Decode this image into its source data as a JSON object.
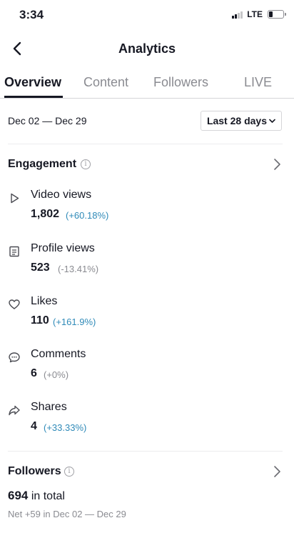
{
  "status_bar": {
    "time": "3:34",
    "network": "LTE"
  },
  "nav": {
    "title": "Analytics"
  },
  "tabs": [
    {
      "label": "Overview",
      "active": true
    },
    {
      "label": "Content",
      "active": false
    },
    {
      "label": "Followers",
      "active": false
    },
    {
      "label": "LIVE",
      "active": false
    }
  ],
  "date_range": "Dec 02 — Dec 29",
  "period_select": {
    "label": "Last 28 days"
  },
  "engagement": {
    "title": "Engagement",
    "info_icon": "i",
    "metrics": [
      {
        "icon": "play-icon",
        "label": "Video views",
        "value": "1,802",
        "change": "(+60.18%)",
        "trend": "positive"
      },
      {
        "icon": "profile-icon",
        "label": "Profile views",
        "value": "523",
        "change": "(-13.41%)",
        "trend": "neutral"
      },
      {
        "icon": "heart-icon",
        "label": "Likes",
        "value": "110",
        "change": "(+161.9%)",
        "trend": "positive"
      },
      {
        "icon": "comment-icon",
        "label": "Comments",
        "value": "6",
        "change": "(+0%)",
        "trend": "neutral"
      },
      {
        "icon": "share-icon",
        "label": "Shares",
        "value": "4",
        "change": "(+33.33%)",
        "trend": "positive"
      }
    ]
  },
  "followers": {
    "title": "Followers",
    "info_icon": "i",
    "total": "694",
    "total_suffix": "in total",
    "net": "Net +59 in Dec 02 — Dec 29"
  },
  "colors": {
    "positive": "#2f8ab8",
    "neutral": "#8a8b91",
    "text": "#161823"
  }
}
